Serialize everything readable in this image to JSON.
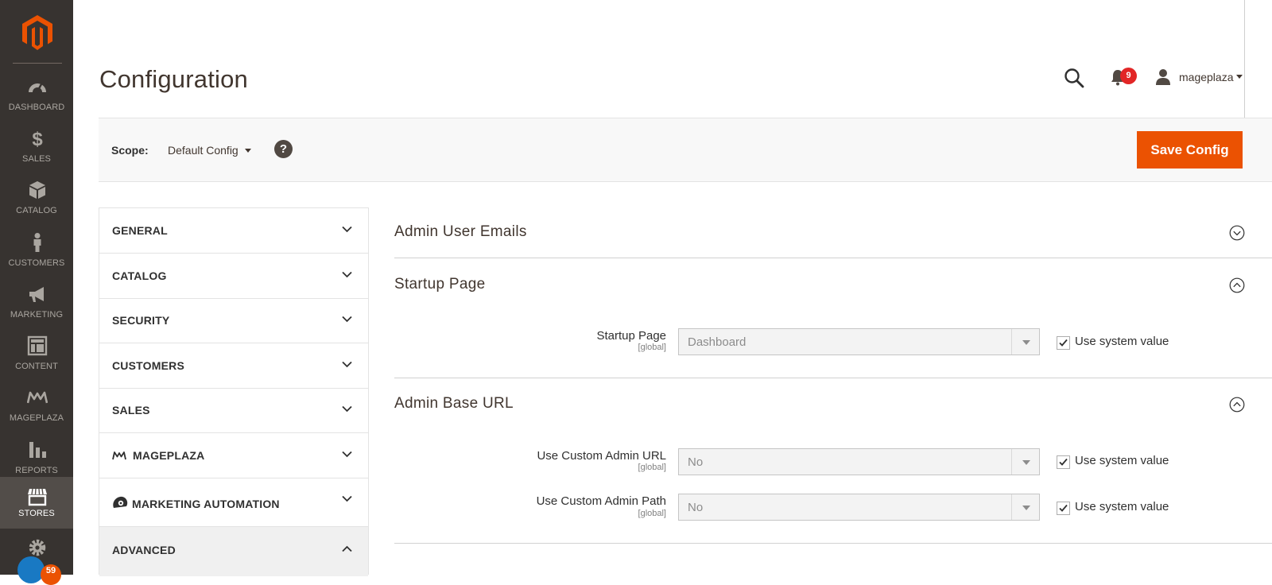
{
  "menu": {
    "items": [
      {
        "label": "DASHBOARD",
        "icon": "dashboard-icon"
      },
      {
        "label": "SALES",
        "icon": "dollar-icon"
      },
      {
        "label": "CATALOG",
        "icon": "box-icon"
      },
      {
        "label": "CUSTOMERS",
        "icon": "person-icon"
      },
      {
        "label": "MARKETING",
        "icon": "megaphone-icon"
      },
      {
        "label": "CONTENT",
        "icon": "layout-icon"
      },
      {
        "label": "MAGEPLAZA",
        "icon": "mageplaza-icon"
      },
      {
        "label": "REPORTS",
        "icon": "bar-chart-icon"
      },
      {
        "label": "STORES",
        "icon": "store-icon"
      }
    ],
    "system_badge": "59"
  },
  "header": {
    "title": "Configuration",
    "notifications_count": "9",
    "user_name": "mageplaza"
  },
  "scope": {
    "label": "Scope:",
    "value": "Default Config",
    "help": "?",
    "save_label": "Save Config"
  },
  "nav": {
    "items": [
      {
        "label": "GENERAL"
      },
      {
        "label": "CATALOG"
      },
      {
        "label": "SECURITY"
      },
      {
        "label": "CUSTOMERS"
      },
      {
        "label": "SALES"
      },
      {
        "label": "MAGEPLAZA"
      },
      {
        "label": "MARKETING AUTOMATION"
      },
      {
        "label": "ADVANCED"
      }
    ]
  },
  "sections": {
    "admin_user_emails": {
      "title": "Admin User Emails"
    },
    "startup_page": {
      "title": "Startup Page",
      "field": {
        "label": "Startup Page",
        "scope": "[global]",
        "value": "Dashboard",
        "system_label": "Use system value"
      }
    },
    "admin_base_url": {
      "title": "Admin Base URL",
      "custom_url": {
        "label": "Use Custom Admin URL",
        "scope": "[global]",
        "value": "No",
        "system_label": "Use system value"
      },
      "custom_path": {
        "label": "Use Custom Admin Path",
        "scope": "[global]",
        "value": "No",
        "system_label": "Use system value"
      }
    }
  },
  "colors": {
    "accent": "#eb5202",
    "menu_bg": "#373330",
    "notif_badge": "#e22626"
  }
}
